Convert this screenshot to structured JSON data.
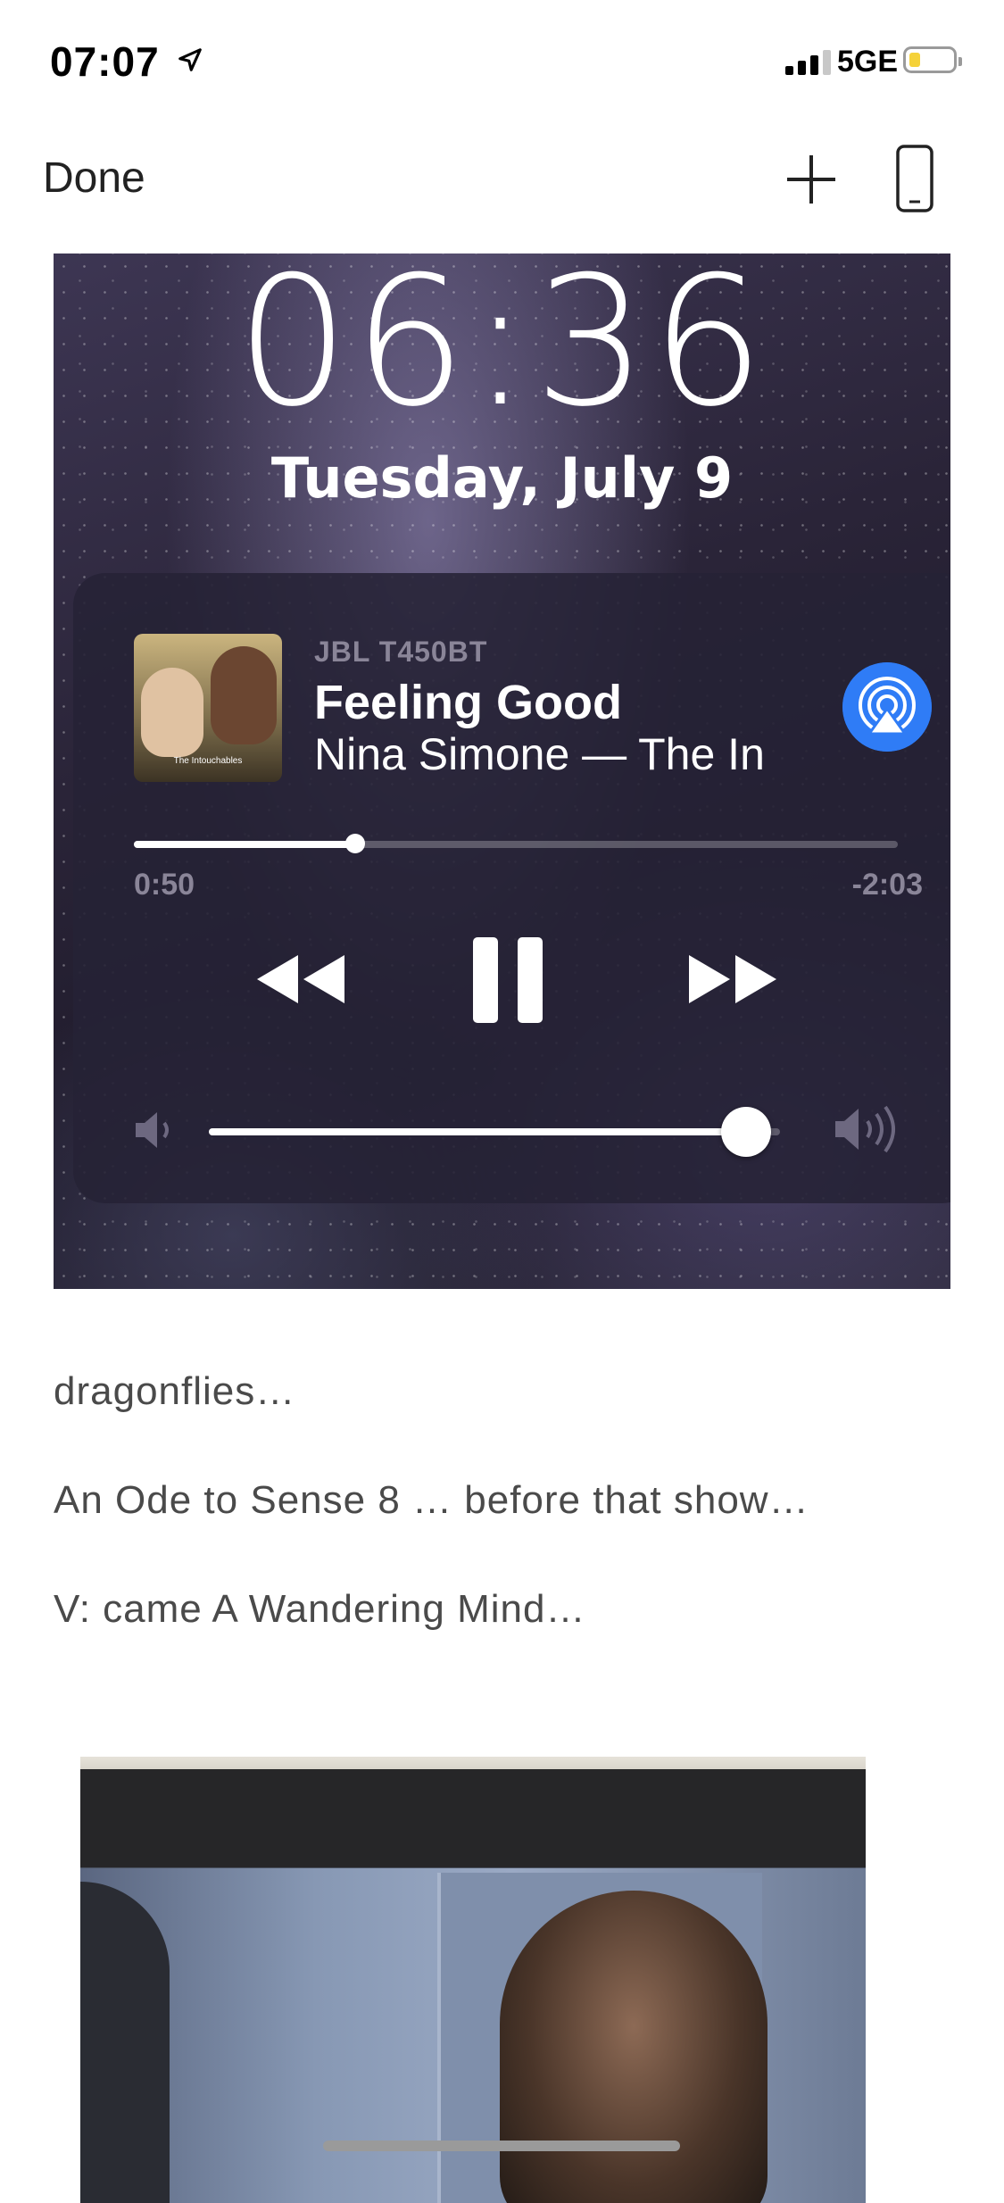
{
  "status_bar": {
    "time": "07:07",
    "network": "5GE",
    "location_icon": "location-arrow-icon",
    "battery_color": "#f5d23a"
  },
  "nav": {
    "done_label": "Done",
    "add_icon": "plus-icon",
    "device_icon": "phone-icon"
  },
  "lockscreen": {
    "time": "06:36",
    "date": "Tuesday, July 9",
    "player": {
      "device": "JBL T450BT",
      "title": "Feeling Good",
      "artist_album": "Nina Simone — The In",
      "album_art_text": "The Intouchables",
      "elapsed": "0:50",
      "remaining": "-2:03",
      "progress_fraction": 0.29,
      "volume_fraction": 0.94,
      "airplay_color": "#2f7cf6"
    }
  },
  "paragraphs": [
    "dragonflies…",
    "An Ode to Sense 8 … before that show…",
    "V: came A Wandering Mind…"
  ]
}
